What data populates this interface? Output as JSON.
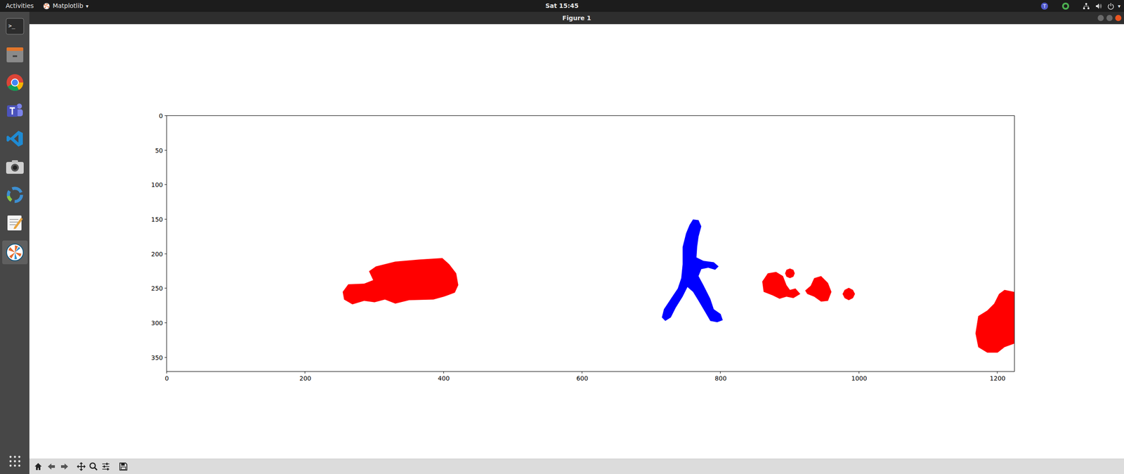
{
  "topbar": {
    "activities": "Activities",
    "app_menu": "Matplotlib",
    "app_menu_arrow": "▾",
    "clock": "Sat 15:45",
    "system_arrow": "▾"
  },
  "window": {
    "title": "Figure 1"
  },
  "chart": {
    "x_range": [
      0,
      1224
    ],
    "y_range": [
      0,
      370
    ],
    "x_ticks": [
      "0",
      "200",
      "400",
      "600",
      "800",
      "1000",
      "1200"
    ],
    "y_ticks": [
      "0",
      "50",
      "100",
      "150",
      "200",
      "250",
      "300",
      "350"
    ],
    "regions": [
      {
        "color": "#ff0000",
        "points": [
          [
            254,
            255
          ],
          [
            262,
            244
          ],
          [
            285,
            243
          ],
          [
            298,
            238
          ],
          [
            292,
            225
          ],
          [
            302,
            218
          ],
          [
            330,
            211
          ],
          [
            365,
            208
          ],
          [
            398,
            206
          ],
          [
            408,
            215
          ],
          [
            418,
            228
          ],
          [
            421,
            245
          ],
          [
            416,
            256
          ],
          [
            400,
            262
          ],
          [
            385,
            266
          ],
          [
            350,
            267
          ],
          [
            330,
            272
          ],
          [
            315,
            266
          ],
          [
            300,
            270
          ],
          [
            285,
            268
          ],
          [
            268,
            273
          ],
          [
            256,
            266
          ]
        ]
      },
      {
        "color": "#0000ff",
        "points": [
          [
            760,
            150
          ],
          [
            768,
            151
          ],
          [
            772,
            160
          ],
          [
            768,
            175
          ],
          [
            766,
            190
          ],
          [
            765,
            205
          ],
          [
            775,
            210
          ],
          [
            790,
            212
          ],
          [
            797,
            218
          ],
          [
            792,
            223
          ],
          [
            782,
            220
          ],
          [
            772,
            222
          ],
          [
            768,
            232
          ],
          [
            775,
            245
          ],
          [
            785,
            265
          ],
          [
            790,
            280
          ],
          [
            800,
            287
          ],
          [
            803,
            296
          ],
          [
            795,
            299
          ],
          [
            785,
            297
          ],
          [
            778,
            285
          ],
          [
            768,
            268
          ],
          [
            760,
            255
          ],
          [
            752,
            248
          ],
          [
            745,
            262
          ],
          [
            735,
            278
          ],
          [
            728,
            292
          ],
          [
            720,
            297
          ],
          [
            715,
            292
          ],
          [
            718,
            280
          ],
          [
            728,
            265
          ],
          [
            738,
            250
          ],
          [
            743,
            235
          ],
          [
            745,
            215
          ],
          [
            745,
            190
          ],
          [
            750,
            170
          ],
          [
            755,
            158
          ]
        ]
      },
      {
        "color": "#ff0000",
        "points": [
          [
            860,
            240
          ],
          [
            868,
            228
          ],
          [
            880,
            226
          ],
          [
            890,
            232
          ],
          [
            895,
            245
          ],
          [
            900,
            252
          ],
          [
            908,
            250
          ],
          [
            915,
            258
          ],
          [
            905,
            264
          ],
          [
            895,
            262
          ],
          [
            885,
            265
          ],
          [
            875,
            260
          ],
          [
            862,
            255
          ]
        ]
      },
      {
        "color": "#ff0000",
        "points": [
          [
            907,
            228
          ],
          [
            905,
            233
          ],
          [
            900,
            235
          ],
          [
            895,
            233
          ],
          [
            893,
            228
          ],
          [
            895,
            223
          ],
          [
            900,
            221
          ],
          [
            905,
            223
          ]
        ]
      },
      {
        "color": "#ff0000",
        "points": [
          [
            922,
            253
          ],
          [
            930,
            246
          ],
          [
            935,
            235
          ],
          [
            945,
            232
          ],
          [
            955,
            242
          ],
          [
            960,
            255
          ],
          [
            955,
            268
          ],
          [
            945,
            269
          ],
          [
            935,
            262
          ],
          [
            925,
            258
          ]
        ]
      },
      {
        "color": "#ff0000",
        "points": [
          [
            994,
            258
          ],
          [
            991,
            264
          ],
          [
            985,
            267
          ],
          [
            979,
            264
          ],
          [
            976,
            258
          ],
          [
            979,
            252
          ],
          [
            985,
            249
          ],
          [
            991,
            252
          ]
        ]
      },
      {
        "color": "#ff0000",
        "points": [
          [
            1172,
            290
          ],
          [
            1185,
            282
          ],
          [
            1195,
            272
          ],
          [
            1202,
            258
          ],
          [
            1210,
            252
          ],
          [
            1224,
            255
          ],
          [
            1224,
            330
          ],
          [
            1210,
            335
          ],
          [
            1200,
            343
          ],
          [
            1185,
            343
          ],
          [
            1172,
            335
          ],
          [
            1168,
            315
          ]
        ]
      }
    ]
  }
}
